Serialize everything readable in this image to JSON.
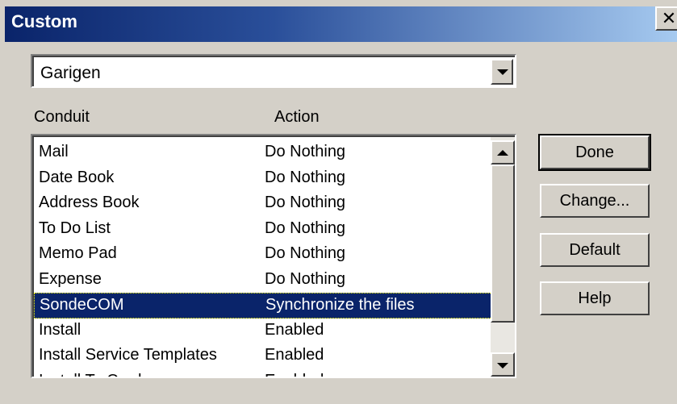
{
  "window": {
    "title": "Custom",
    "close_glyph": "✕"
  },
  "handheld_select": {
    "value": "Garigen"
  },
  "columns": {
    "conduit": "Conduit",
    "action": "Action"
  },
  "conduits": [
    {
      "conduit": "Mail",
      "action": "Do Nothing"
    },
    {
      "conduit": "Date Book",
      "action": "Do Nothing"
    },
    {
      "conduit": "Address Book",
      "action": "Do Nothing"
    },
    {
      "conduit": "To Do List",
      "action": "Do Nothing"
    },
    {
      "conduit": "Memo Pad",
      "action": "Do Nothing"
    },
    {
      "conduit": "Expense",
      "action": "Do Nothing"
    },
    {
      "conduit": "SondeCOM",
      "action": "Synchronize the files",
      "selected": true
    },
    {
      "conduit": "Install",
      "action": "Enabled"
    },
    {
      "conduit": "Install Service Templates",
      "action": "Enabled"
    },
    {
      "conduit": "Install To Card",
      "action": "Enabled"
    }
  ],
  "buttons": {
    "done": "Done",
    "change": "Change...",
    "default": "Default",
    "help": "Help"
  },
  "icons": {
    "close": "close-icon",
    "dropdown": "chevron-down-icon",
    "scroll_up": "scroll-up-icon",
    "scroll_down": "scroll-down-icon"
  },
  "colors": {
    "title_bar_start": "#0a246a",
    "title_bar_end": "#a6caf0",
    "selection": "#0a246a",
    "face": "#d4d0c8"
  }
}
